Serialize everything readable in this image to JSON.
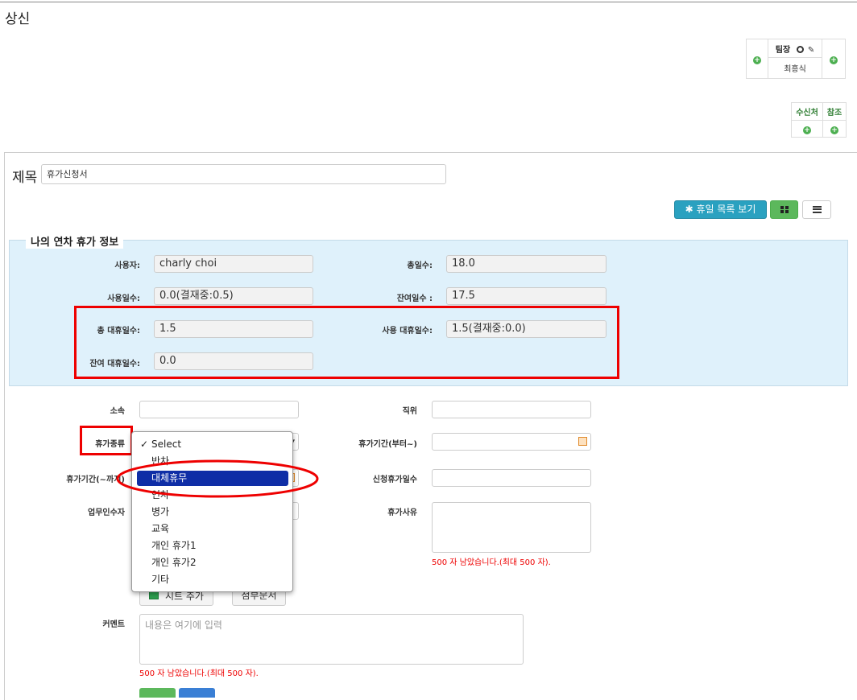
{
  "page": {
    "title": "상신"
  },
  "approval": {
    "role": "팀장",
    "name": "최흥식",
    "recipients_label": "수신처",
    "reference_label": "참조"
  },
  "subject": {
    "label": "제목",
    "value": "휴가신청서"
  },
  "toolbar": {
    "holiday_list_button": "휴일 목록 보기"
  },
  "leave_info": {
    "legend": "나의 연차 휴가 정보",
    "user_label": "사용자:",
    "user_value": "charly choi",
    "total_days_label": "총일수:",
    "total_days_value": "18.0",
    "used_days_label": "사용일수:",
    "used_days_value": "0.0(결재중:0.5)",
    "remaining_days_label": "잔여일수 :",
    "remaining_days_value": "17.5",
    "total_sub_label": "총 대휴일수:",
    "total_sub_value": "1.5",
    "used_sub_label": "사용 대휴일수:",
    "used_sub_value": "1.5(결재중:0.0)",
    "remaining_sub_label": "잔여 대휴일수:",
    "remaining_sub_value": "0.0"
  },
  "form": {
    "department_label": "소속",
    "position_label": "직위",
    "leave_type_label": "휴가종류",
    "start_date_label": "휴가기간(부터~)",
    "end_date_label": "휴가기간(~까지)",
    "request_days_label": "신청휴가일수",
    "handover_label": "업무인수자",
    "reason_label": "휴가사유",
    "reason_remaining": "500 자 남았습니다.(최대 500 자).",
    "add_sheet_button": "시트 추가",
    "attach_button": "첨부문서",
    "comment_label": "커멘트",
    "comment_placeholder": "내용은 여기에 입력",
    "comment_remaining": "500 자 남았습니다.(최대 500 자)."
  },
  "leave_type_dropdown": {
    "options": [
      "Select",
      "반차",
      "대체휴무",
      "연차",
      "병가",
      "교육",
      "개인 휴가1",
      "개인 휴가2",
      "기타"
    ],
    "checked": "Select",
    "highlighted": "대체휴무"
  },
  "colors": {
    "highlight": "#0f2ea6",
    "annotation_red": "#ee0000",
    "info_bg": "#dff1fb"
  }
}
